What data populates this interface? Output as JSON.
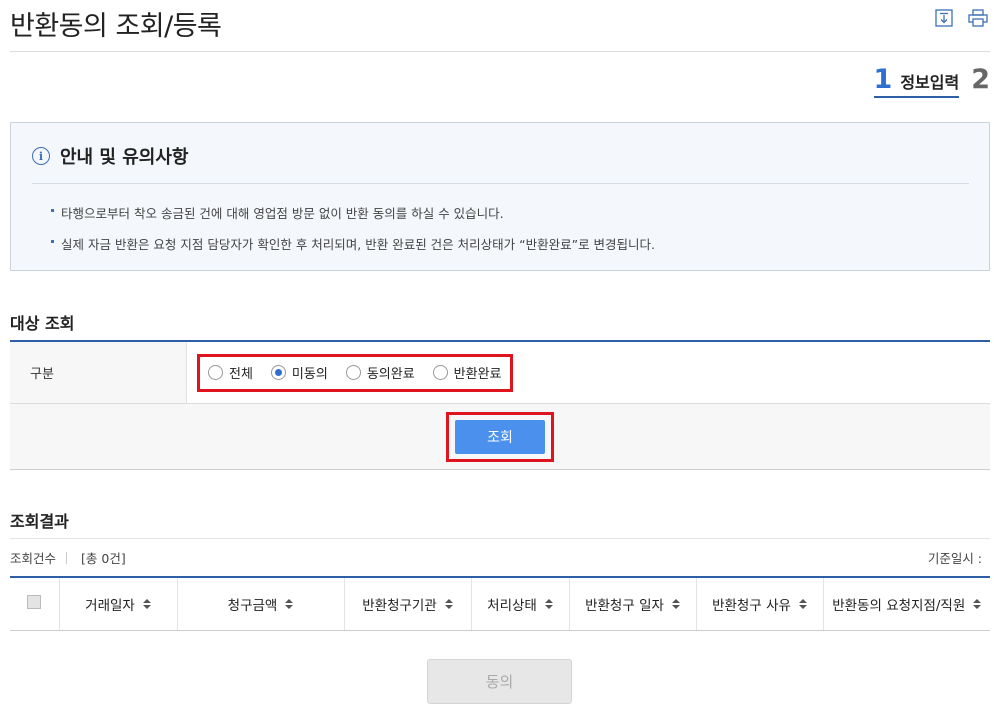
{
  "page": {
    "title": "반환동의 조회/등록"
  },
  "tools": {
    "download_icon": "download-icon",
    "print_icon": "print-icon"
  },
  "steps": {
    "current_number": "1",
    "current_label": "정보입력",
    "next_number": "2"
  },
  "notice": {
    "title": "안내 및 유의사항",
    "items": [
      "타행으로부터 착오 송금된 건에 대해 영업점 방문 없이 반환 동의를 하실 수 있습니다.",
      "실제 자금 반환은 요청 지점 담당자가 확인한 후 처리되며, 반환 완료된 건은 처리상태가 “반환완료”로 변경됩니다."
    ]
  },
  "search": {
    "section_title": "대상 조회",
    "label": "구분",
    "options": [
      {
        "label": "전체",
        "selected": false
      },
      {
        "label": "미동의",
        "selected": true
      },
      {
        "label": "동의완료",
        "selected": false
      },
      {
        "label": "반환완료",
        "selected": false
      }
    ],
    "button_label": "조회"
  },
  "result": {
    "section_title": "조회결과",
    "count_label": "조회건수",
    "count_value": "[총 0건]",
    "base_date_label": "기준일시 :",
    "columns": [
      "거래일자",
      "청구금액",
      "반환청구기관",
      "처리상태",
      "반환청구 일자",
      "반환청구 사유",
      "반환동의 요청지점/직원"
    ],
    "rows": []
  },
  "actions": {
    "agree_label": "동의"
  },
  "colors": {
    "accent": "#2e5ea6",
    "primary_button": "#4a90ec",
    "highlight_border": "#e0141e",
    "notice_bg": "#f4f7fb"
  }
}
